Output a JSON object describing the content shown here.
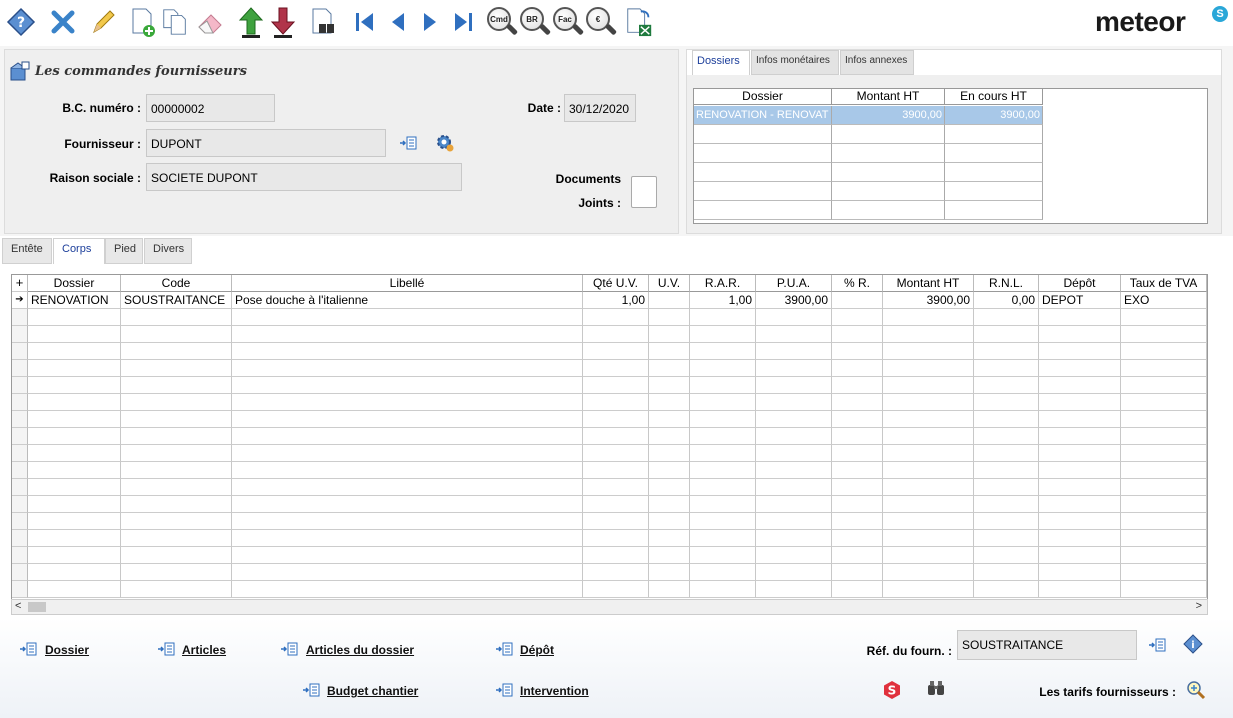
{
  "toolbar": {
    "icons": [
      "help-icon",
      "cancel-icon",
      "edit-pencil-icon",
      "new-document-icon",
      "duplicate-icon",
      "eraser-icon",
      "move-up-green-icon",
      "move-down-red-icon",
      "search-binoculars-doc-icon",
      "first-record-icon",
      "previous-record-icon",
      "next-record-icon",
      "last-record-icon"
    ],
    "lookup_buttons": [
      "Cmd",
      "BR",
      "Fac",
      "€"
    ],
    "brand": "meteor",
    "brand_mark": "S"
  },
  "header": {
    "title": "Les commandes fournisseurs",
    "bc_label": "B.C. numéro :",
    "bc_value": "00000002",
    "date_label": "Date :",
    "date_value": "30/12/2020",
    "fournisseur_label": "Fournisseur :",
    "fournisseur_value": "DUPONT",
    "raison_label": "Raison sociale :",
    "raison_value": "SOCIETE DUPONT",
    "documents_label": "Documents",
    "joints_label": "Joints :"
  },
  "right_panel": {
    "tabs": [
      "Dossiers",
      "Infos monétaires",
      "Infos annexes"
    ],
    "columns": [
      "Dossier",
      "Montant HT",
      "En cours HT"
    ],
    "rows": [
      [
        "RENOVATION - RENOVAT",
        "3900,00",
        "3900,00"
      ]
    ]
  },
  "lower_tabs": [
    "Entête",
    "Corps",
    "Pied",
    "Divers"
  ],
  "grid": {
    "corner": "+",
    "columns": [
      "Dossier",
      "Code",
      "Libellé",
      "Qté U.V.",
      "U.V.",
      "R.A.R.",
      "P.U.A.",
      "% R.",
      "Montant HT",
      "R.N.L.",
      "Dépôt",
      "Taux de TVA"
    ],
    "rows": [
      [
        "RENOVATION",
        "SOUSTRAITANCE",
        "Pose douche à l'italienne",
        "1,00",
        "",
        "1,00",
        "3900,00",
        "",
        "3900,00",
        "0,00",
        "DEPOT",
        "EXO"
      ]
    ]
  },
  "bottom": {
    "dossier": "Dossier",
    "articles": "Articles",
    "articles_dossier": "Articles du dossier",
    "depot": "Dépôt",
    "budget": "Budget chantier",
    "intervention": "Intervention",
    "ref_label": "Réf. du fourn. :",
    "ref_value": "SOUSTRAITANCE",
    "tarifs_label": "Les tarifs fournisseurs :"
  },
  "colors": {
    "accent": "#1d3f9b",
    "selection": "#a8c8e8",
    "brand_blue": "#2aa7d8"
  }
}
